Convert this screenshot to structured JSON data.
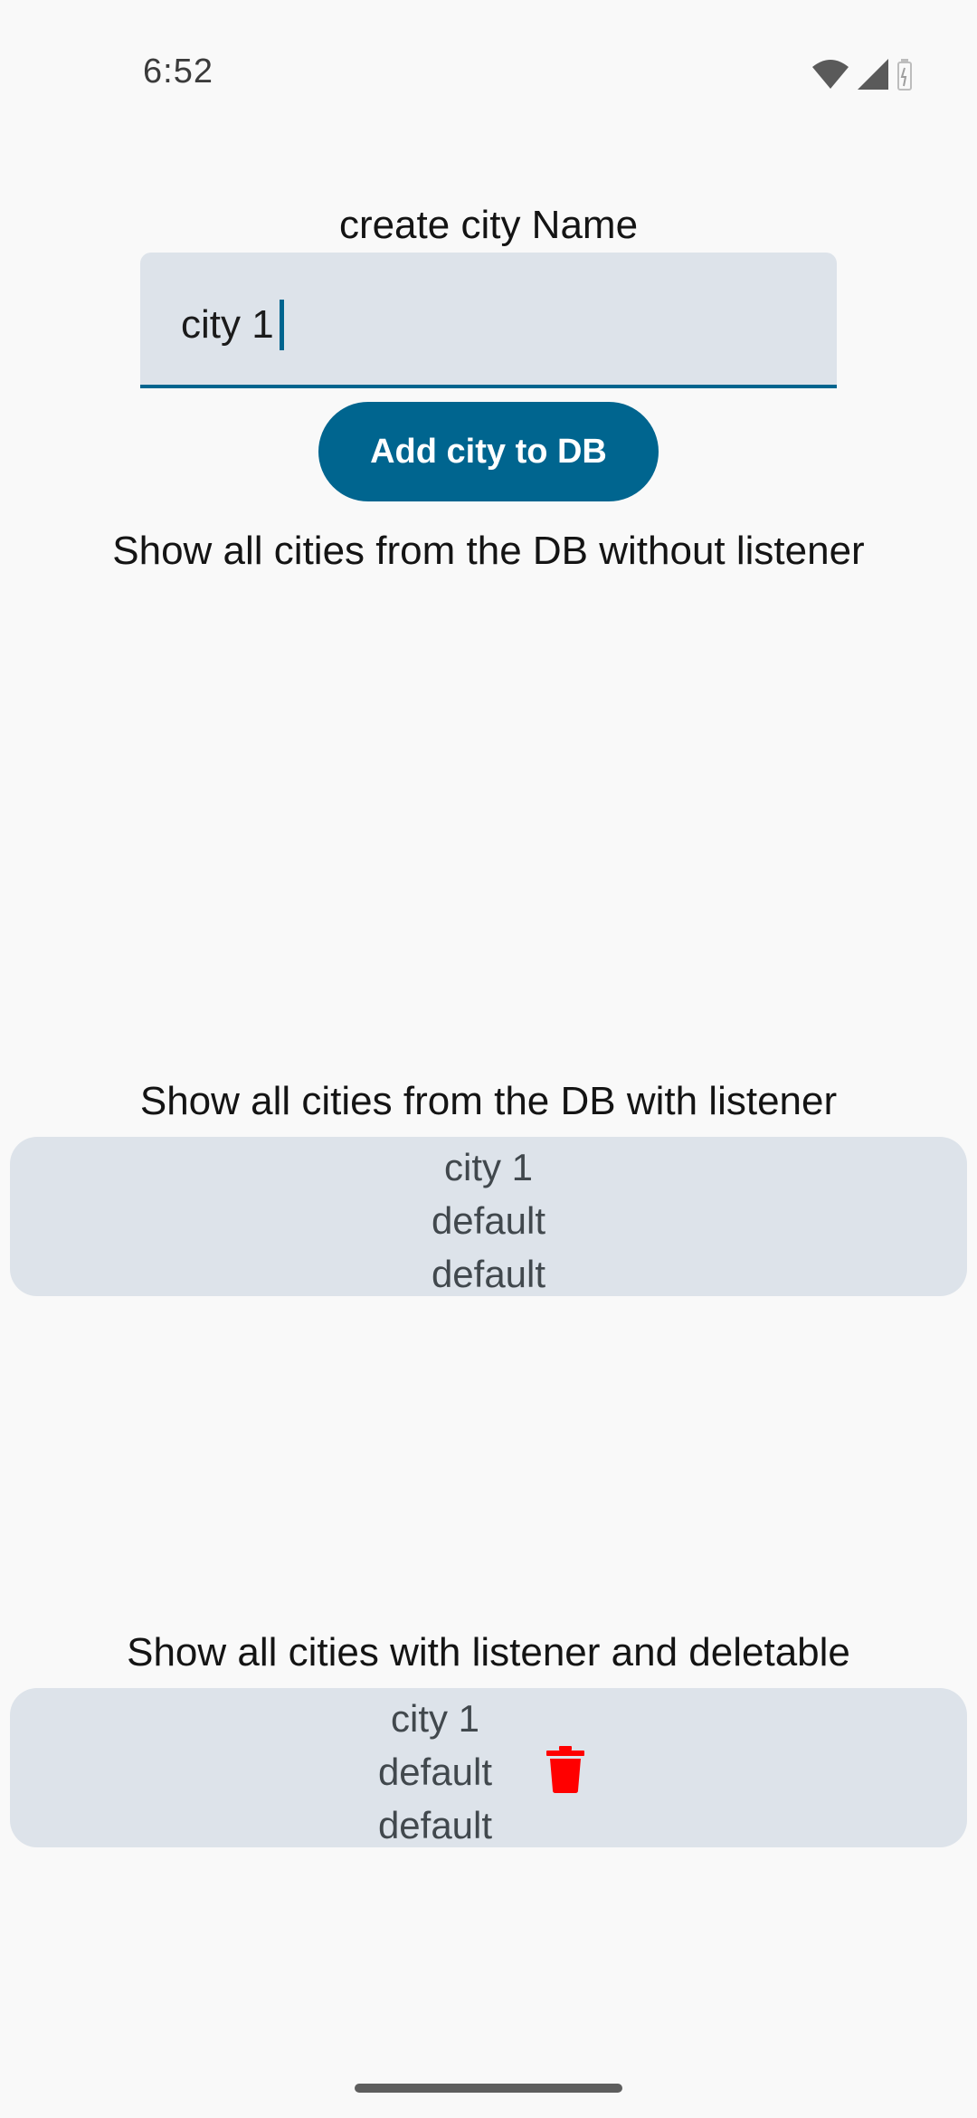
{
  "status_bar": {
    "time": "6:52",
    "icons": [
      "wifi-icon",
      "cell-signal-icon",
      "battery-icon"
    ]
  },
  "form": {
    "label": "create city Name",
    "input_value": "city 1",
    "add_button_label": "Add city to DB"
  },
  "section_no_listener": {
    "label": "Show all cities from the DB without listener",
    "items": []
  },
  "section_listener": {
    "label": "Show all cities from the DB with listener",
    "items": [
      {
        "name": "city 1",
        "field2": "default",
        "field3": "default"
      }
    ]
  },
  "section_deletable": {
    "label": "Show all cities with listener and deletable",
    "items": [
      {
        "name": "city 1",
        "field2": "default",
        "field3": "default",
        "delete_icon": "trash-icon"
      }
    ]
  },
  "colors": {
    "primary": "#00658f",
    "surface_variant": "#dde3ea",
    "background": "#f9f9f9",
    "delete": "#ff0000"
  }
}
